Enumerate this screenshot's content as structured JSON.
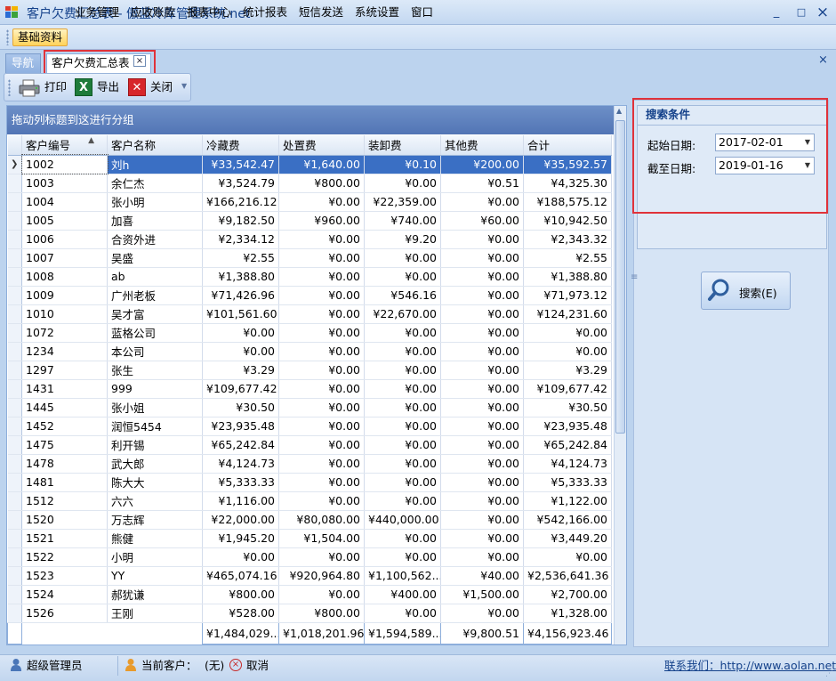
{
  "window": {
    "title": "客户欠费汇总表 - 傲蓝冷库管理系统.net",
    "minimize": "_",
    "restore": "□",
    "close": "×"
  },
  "menu": [
    "基础资料",
    "业务管理",
    "应收账款",
    "报表中心",
    "统计报表",
    "短信发送",
    "系统设置",
    "窗口"
  ],
  "tabs": {
    "nav": "导航",
    "report": "客户欠费汇总表",
    "close_glyph": "×",
    "panel_close": "×"
  },
  "toolbar": {
    "print": "打印",
    "export": "导出",
    "close": "关闭"
  },
  "grid": {
    "group_panel": "拖动列标题到这进行分组",
    "headers": [
      "客户编号",
      "客户名称",
      "冷藏费",
      "处置费",
      "装卸费",
      "其他费",
      "合计"
    ],
    "sort_glyph": "▲",
    "rows": [
      [
        "1002",
        "刘h",
        "¥33,542.47",
        "¥1,640.00",
        "¥0.10",
        "¥200.00",
        "¥35,592.57"
      ],
      [
        "1003",
        "余仁杰",
        "¥3,524.79",
        "¥800.00",
        "¥0.00",
        "¥0.51",
        "¥4,325.30"
      ],
      [
        "1004",
        "张小明",
        "¥166,216.12",
        "¥0.00",
        "¥22,359.00",
        "¥0.00",
        "¥188,575.12"
      ],
      [
        "1005",
        "加喜",
        "¥9,182.50",
        "¥960.00",
        "¥740.00",
        "¥60.00",
        "¥10,942.50"
      ],
      [
        "1006",
        "合资外进",
        "¥2,334.12",
        "¥0.00",
        "¥9.20",
        "¥0.00",
        "¥2,343.32"
      ],
      [
        "1007",
        "吴盛",
        "¥2.55",
        "¥0.00",
        "¥0.00",
        "¥0.00",
        "¥2.55"
      ],
      [
        "1008",
        "ab",
        "¥1,388.80",
        "¥0.00",
        "¥0.00",
        "¥0.00",
        "¥1,388.80"
      ],
      [
        "1009",
        "广州老板",
        "¥71,426.96",
        "¥0.00",
        "¥546.16",
        "¥0.00",
        "¥71,973.12"
      ],
      [
        "1010",
        "吴才富",
        "¥101,561.60",
        "¥0.00",
        "¥22,670.00",
        "¥0.00",
        "¥124,231.60"
      ],
      [
        "1072",
        "蓝格公司",
        "¥0.00",
        "¥0.00",
        "¥0.00",
        "¥0.00",
        "¥0.00"
      ],
      [
        "1234",
        "本公司",
        "¥0.00",
        "¥0.00",
        "¥0.00",
        "¥0.00",
        "¥0.00"
      ],
      [
        "1297",
        "张生",
        "¥3.29",
        "¥0.00",
        "¥0.00",
        "¥0.00",
        "¥3.29"
      ],
      [
        "1431",
        "999",
        "¥109,677.42",
        "¥0.00",
        "¥0.00",
        "¥0.00",
        "¥109,677.42"
      ],
      [
        "1445",
        "张小姐",
        "¥30.50",
        "¥0.00",
        "¥0.00",
        "¥0.00",
        "¥30.50"
      ],
      [
        "1452",
        "润恒5454",
        "¥23,935.48",
        "¥0.00",
        "¥0.00",
        "¥0.00",
        "¥23,935.48"
      ],
      [
        "1475",
        "利开锡",
        "¥65,242.84",
        "¥0.00",
        "¥0.00",
        "¥0.00",
        "¥65,242.84"
      ],
      [
        "1478",
        "武大郎",
        "¥4,124.73",
        "¥0.00",
        "¥0.00",
        "¥0.00",
        "¥4,124.73"
      ],
      [
        "1481",
        "陈大大",
        "¥5,333.33",
        "¥0.00",
        "¥0.00",
        "¥0.00",
        "¥5,333.33"
      ],
      [
        "1512",
        "六六",
        "¥1,116.00",
        "¥0.00",
        "¥0.00",
        "¥0.00",
        "¥1,122.00"
      ],
      [
        "1520",
        "万志辉",
        "¥22,000.00",
        "¥80,080.00",
        "¥440,000.00",
        "¥0.00",
        "¥542,166.00"
      ],
      [
        "1521",
        "熊健",
        "¥1,945.20",
        "¥1,504.00",
        "¥0.00",
        "¥0.00",
        "¥3,449.20"
      ],
      [
        "1522",
        "小明",
        "¥0.00",
        "¥0.00",
        "¥0.00",
        "¥0.00",
        "¥0.00"
      ],
      [
        "1523",
        "YY",
        "¥465,074.16",
        "¥920,964.80",
        "¥1,100,562....",
        "¥40.00",
        "¥2,536,641.36"
      ],
      [
        "1524",
        "郝犹谦",
        "¥800.00",
        "¥0.00",
        "¥400.00",
        "¥1,500.00",
        "¥2,700.00"
      ],
      [
        "1526",
        "王刚",
        "¥528.00",
        "¥800.00",
        "¥0.00",
        "¥0.00",
        "¥1,328.00"
      ]
    ],
    "totals": [
      "",
      "",
      "¥1,484,029....",
      "¥1,018,201.96",
      "¥1,594,589....",
      "¥9,800.51",
      "¥4,156,923.46"
    ]
  },
  "search": {
    "title": "搜索条件",
    "start_label": "起始日期:",
    "start_value": "2017-02-01",
    "end_label": "截至日期:",
    "end_value": "2019-01-16",
    "button": "搜索(E)"
  },
  "status": {
    "user": "超级管理员",
    "customer_label": "当前客户：",
    "customer_value": "(无)",
    "cancel": "取消",
    "contact_label": "联系我们：",
    "contact_url": "http://www.aolan.net"
  },
  "colors": {
    "selection": "#3a6fc4",
    "highlight_box": "#e0323a",
    "title_text": "#15428b"
  }
}
